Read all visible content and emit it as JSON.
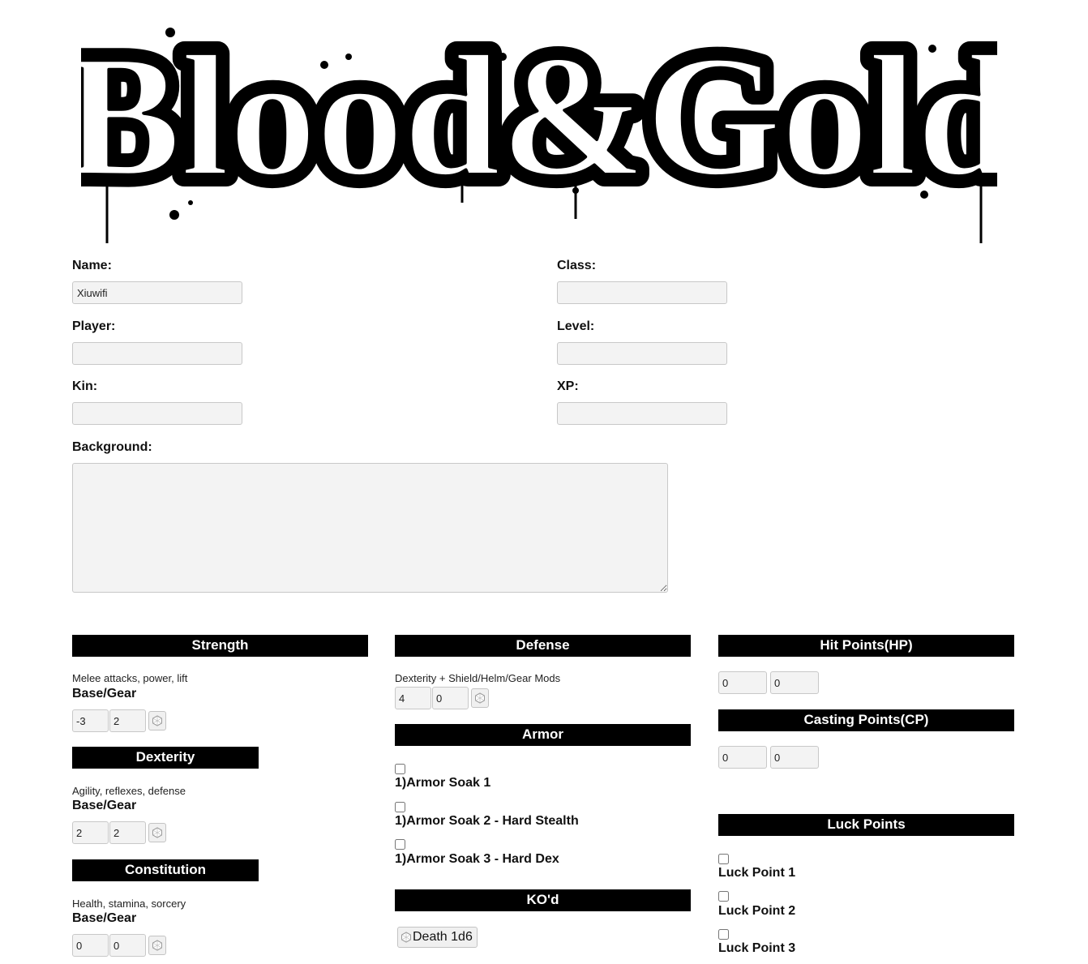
{
  "logo": {
    "text": "Blood&Gold"
  },
  "fields": {
    "name": {
      "label": "Name:",
      "value": "Xiuwifi"
    },
    "player": {
      "label": "Player:",
      "value": ""
    },
    "kin": {
      "label": "Kin:",
      "value": ""
    },
    "class": {
      "label": "Class:",
      "value": ""
    },
    "level": {
      "label": "Level:",
      "value": ""
    },
    "xp": {
      "label": "XP:",
      "value": ""
    },
    "background": {
      "label": "Background:",
      "value": ""
    }
  },
  "attributes": {
    "strength": {
      "title": "Strength",
      "desc": "Melee attacks, power, lift",
      "sub": "Base/Gear",
      "base": "-3",
      "gear": "2"
    },
    "dexterity": {
      "title": "Dexterity",
      "desc": "Agility, reflexes, defense",
      "sub": "Base/Gear",
      "base": "2",
      "gear": "2"
    },
    "constitution": {
      "title": "Constitution",
      "desc": "Health, stamina, sorcery",
      "sub": "Base/Gear",
      "base": "0",
      "gear": "0"
    }
  },
  "defense": {
    "title": "Defense",
    "desc": "Dexterity + Shield/Helm/Gear Mods",
    "base": "4",
    "mod": "0"
  },
  "armor": {
    "title": "Armor",
    "items": [
      "1)Armor Soak 1",
      "1)Armor Soak 2 - Hard Stealth",
      "1)Armor Soak 3 - Hard Dex"
    ]
  },
  "kod": {
    "title": "KO'd",
    "button": "Death 1d6"
  },
  "hp": {
    "title": "Hit Points(HP)",
    "current": "0",
    "max": "0"
  },
  "cp": {
    "title": "Casting Points(CP)",
    "current": "0",
    "max": "0"
  },
  "luck": {
    "title": "Luck Points",
    "items": [
      "Luck Point 1",
      "Luck Point 2",
      "Luck Point 3"
    ]
  },
  "icons": {
    "roll": "dice-icon"
  }
}
